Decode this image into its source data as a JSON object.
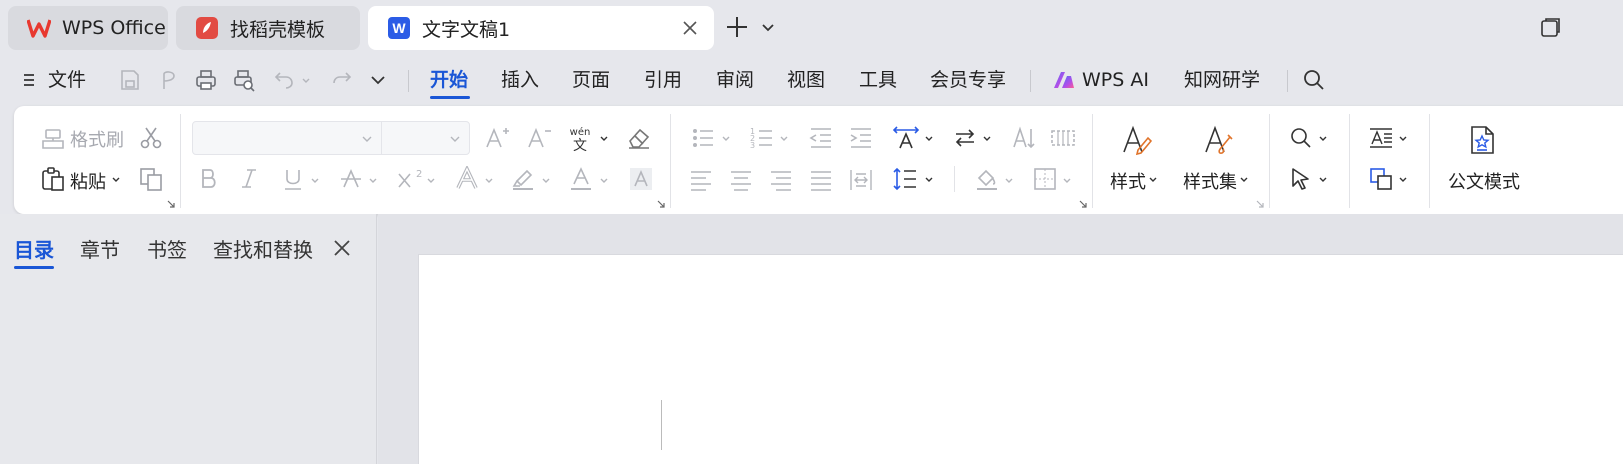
{
  "tabs": {
    "wps": {
      "label": "WPS Office"
    },
    "template": {
      "label": "找稻壳模板"
    },
    "document": {
      "label": "文字文稿1"
    }
  },
  "menubar": {
    "file_label": "文件",
    "tabs": [
      "开始",
      "插入",
      "页面",
      "引用",
      "审阅",
      "视图",
      "工具",
      "会员专享"
    ],
    "ai_label": "WPS AI",
    "research_label": "知网研学"
  },
  "ribbon": {
    "format_painter_label": "格式刷",
    "paste_label": "粘贴",
    "styles_label": "样式",
    "style_set_label": "样式集",
    "official_doc_label": "公文模式",
    "font_name_value": "",
    "font_size_value": ""
  },
  "navpane": {
    "tabs": [
      "目录",
      "章节",
      "书签",
      "查找和替换"
    ]
  },
  "colors": {
    "accent": "#1a56d6",
    "wps_red": "#e8382f",
    "doc_blue": "#2b5ce6",
    "template_red": "#e24b43"
  }
}
